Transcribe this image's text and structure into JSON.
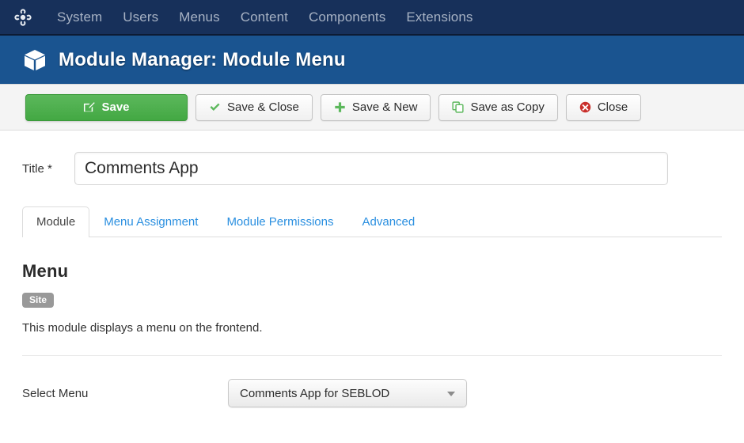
{
  "topnav": {
    "logo_icon": "joomla-logo-icon",
    "items": [
      {
        "label": "System"
      },
      {
        "label": "Users"
      },
      {
        "label": "Menus"
      },
      {
        "label": "Content"
      },
      {
        "label": "Components"
      },
      {
        "label": "Extensions"
      }
    ]
  },
  "pagehead": {
    "icon": "cube-icon",
    "title": "Module Manager: Module Menu",
    "bg_color": "#1a5490"
  },
  "toolbar": {
    "buttons": [
      {
        "label": "Save",
        "icon": "edit-square-icon",
        "style": "primary",
        "accent": "#43a843"
      },
      {
        "label": "Save & Close",
        "icon": "check-icon",
        "style": "default",
        "accent": "#5cb85c"
      },
      {
        "label": "Save & New",
        "icon": "plus-icon",
        "style": "default",
        "accent": "#5cb85c"
      },
      {
        "label": "Save as Copy",
        "icon": "copy-icon",
        "style": "default",
        "accent": "#5cb85c"
      },
      {
        "label": "Close",
        "icon": "close-circle-icon",
        "style": "default",
        "accent": "#c9302c"
      }
    ]
  },
  "form": {
    "title_field": {
      "label": "Title *",
      "value": "Comments App",
      "placeholder": ""
    }
  },
  "tabs": [
    {
      "label": "Module",
      "active": true
    },
    {
      "label": "Menu Assignment",
      "active": false
    },
    {
      "label": "Module Permissions",
      "active": false
    },
    {
      "label": "Advanced",
      "active": false
    }
  ],
  "panel": {
    "heading": "Menu",
    "badge": "Site",
    "badge_color": "#999999",
    "description": "This module displays a menu on the frontend.",
    "select_menu": {
      "label": "Select Menu",
      "value": "Comments App for SEBLOD",
      "options": [
        "Comments App for SEBLOD"
      ]
    }
  }
}
